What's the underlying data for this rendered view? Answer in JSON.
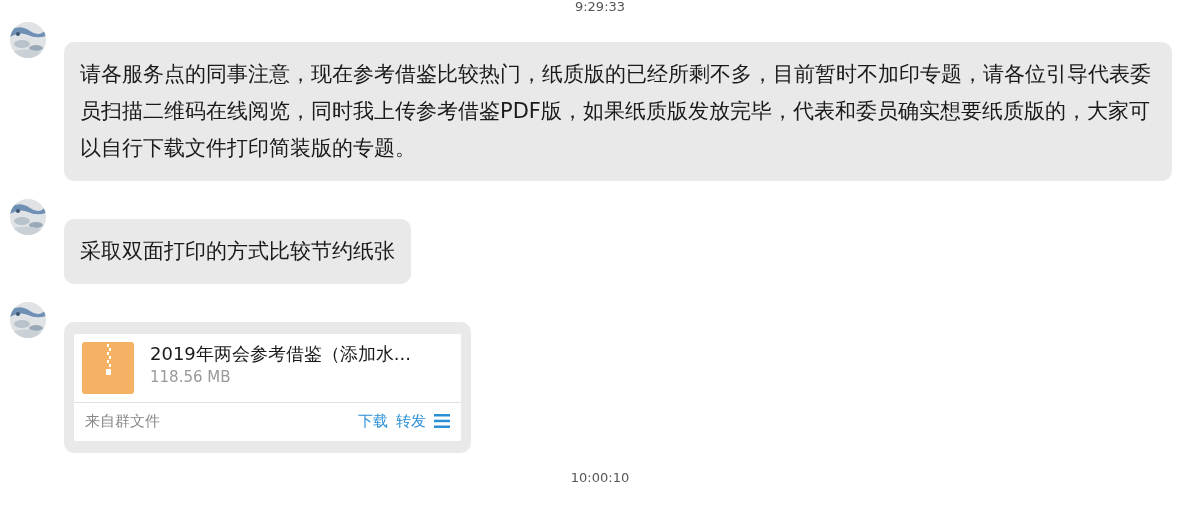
{
  "top_timestamp": "9:29:33",
  "messages": [
    {
      "kind": "text",
      "text": "请各服务点的同事注意，现在参考借鉴比较热门，纸质版的已经所剩不多，目前暂时不加印专题，请各位引导代表委员扫描二维码在线阅览，同时我上传参考借鉴PDF版，如果纸质版发放完毕，代表和委员确实想要纸质版的，大家可以自行下载文件打印简装版的专题。"
    },
    {
      "kind": "text",
      "text": "采取双面打印的方式比较节约纸张"
    },
    {
      "kind": "file",
      "file": {
        "name": "2019年两会参考借鉴（添加水...",
        "size": "118.56 MB",
        "source": "来自群文件",
        "actions": [
          "下载",
          "转发"
        ]
      }
    }
  ],
  "bottom_timestamp": "10:00:10"
}
